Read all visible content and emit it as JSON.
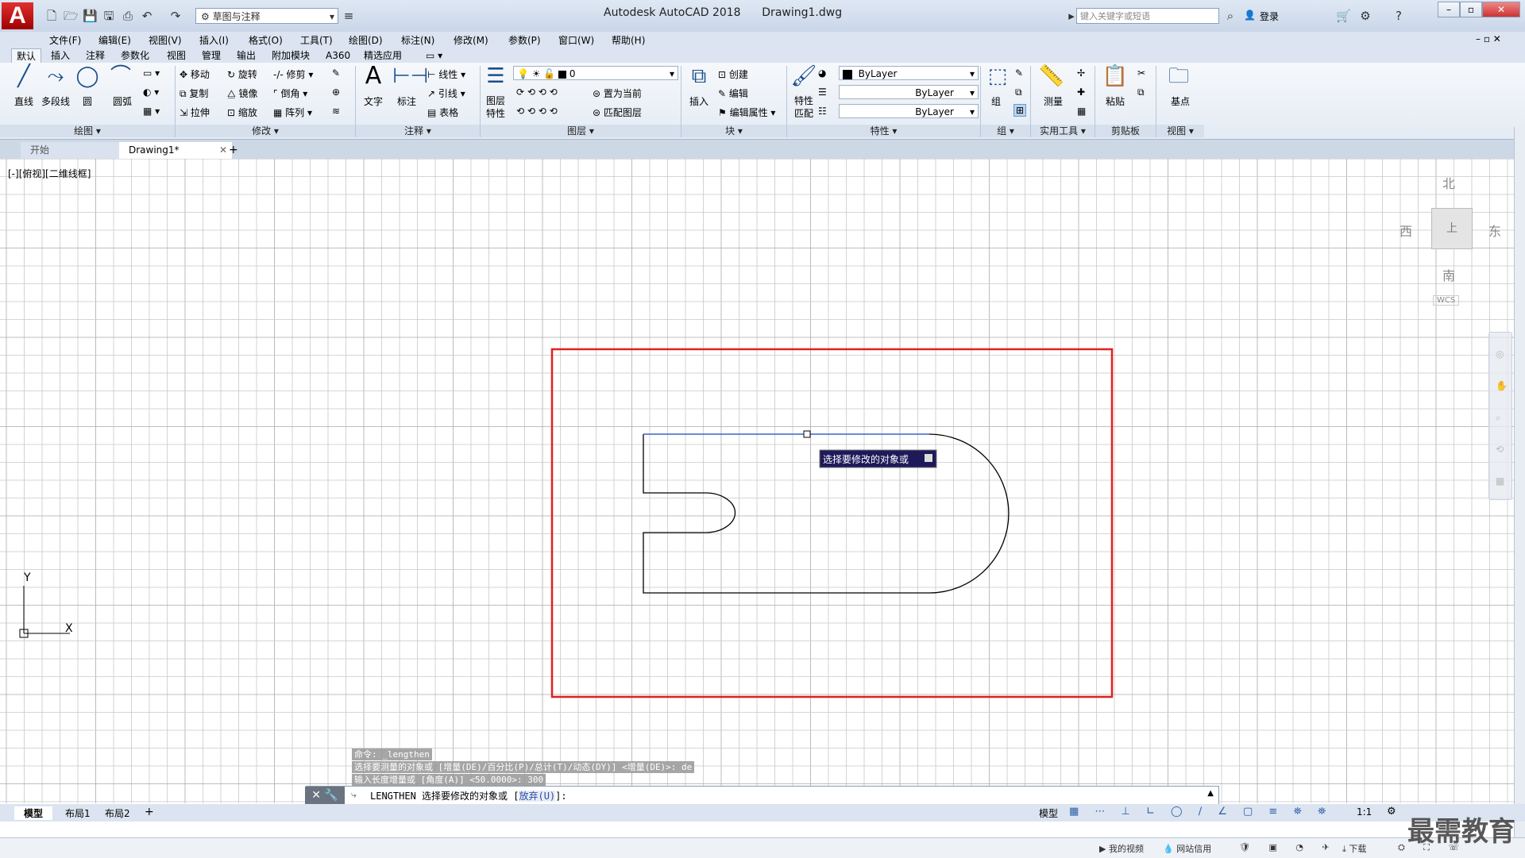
{
  "app": {
    "logo": "A",
    "title": "Autodesk AutoCAD 2018",
    "filename": "Drawing1.dwg",
    "workspace": "草图与注释",
    "search_placeholder": "键入关键字或短语",
    "login": "登录"
  },
  "menu": [
    "文件(F)",
    "编辑(E)",
    "视图(V)",
    "插入(I)",
    "格式(O)",
    "工具(T)",
    "绘图(D)",
    "标注(N)",
    "修改(M)",
    "参数(P)",
    "窗口(W)",
    "帮助(H)"
  ],
  "ribbon_tabs": [
    "默认",
    "插入",
    "注释",
    "参数化",
    "视图",
    "管理",
    "输出",
    "附加模块",
    "A360",
    "精选应用"
  ],
  "ribbon": {
    "draw": {
      "label": "绘图",
      "line": "直线",
      "polyline": "多段线",
      "circle": "圆",
      "arc": "圆弧"
    },
    "modify": {
      "label": "修改",
      "move": "移动",
      "rotate": "旋转",
      "trim": "修剪",
      "copy": "复制",
      "mirror": "镜像",
      "fillet": "倒角",
      "stretch": "拉伸",
      "scale": "缩放",
      "array": "阵列"
    },
    "annotation": {
      "label": "注释",
      "text": "文字",
      "dimension": "标注",
      "linear": "线性",
      "leader": "引线",
      "table": "表格"
    },
    "layers": {
      "label": "图层",
      "properties": "图层\n特性",
      "current_layer": "0",
      "set_current": "置为当前",
      "match_layer": "匹配图层"
    },
    "block": {
      "label": "块",
      "insert": "插入",
      "create": "创建",
      "edit": "编辑",
      "edit_attr": "编辑属性"
    },
    "properties": {
      "label": "特性",
      "match": "特性\n匹配",
      "color": "ByLayer",
      "linetype": "ByLayer",
      "lineweight": "ByLayer"
    },
    "groups": {
      "label": "组",
      "group": "组"
    },
    "utilities": {
      "label": "实用工具",
      "measure": "测量"
    },
    "clipboard": {
      "label": "剪贴板",
      "paste": "粘贴"
    },
    "view": {
      "label": "视图",
      "base": "基点"
    }
  },
  "file_tabs": [
    "开始",
    "Drawing1*"
  ],
  "viewport_label": "[-][俯视][二维线框]",
  "viewcube": {
    "north": "北",
    "south": "南",
    "east": "东",
    "west": "西",
    "top": "上",
    "wcs": "WCS"
  },
  "tooltip": "选择要修改的对象或",
  "ucs": {
    "x": "X",
    "y": "Y"
  },
  "command_history": [
    "命令: _lengthen",
    "选择要测量的对象或 [增量(DE)/百分比(P)/总计(T)/动态(DY)] <增量(DE)>: de",
    "输入长度增量或 [角度(A)] <50.0000>: 300"
  ],
  "command_line": {
    "prefix": "LENGTHEN",
    "text": "选择要修改的对象或 [",
    "option": "放弃(U)",
    "suffix": "]:"
  },
  "layout_tabs": [
    "模型",
    "布局1",
    "布局2"
  ],
  "status": {
    "model": "模型",
    "scale": "1:1"
  },
  "taskbar": {
    "video": "我的视频",
    "credit": "网站信用",
    "download": "下载"
  },
  "watermark": "最需教育",
  "colors": {
    "selection": "#e02020",
    "tooltip_bg": "#1e1a5a",
    "grid": "#c8c8c8",
    "grid_major": "#aaaaaa"
  }
}
